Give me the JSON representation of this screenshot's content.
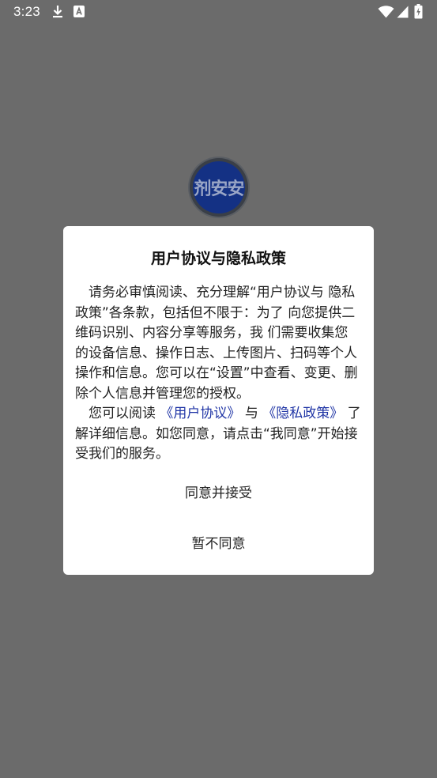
{
  "status_bar": {
    "time": "3:23",
    "icons": [
      "download-icon",
      "font-a-icon",
      "wifi-icon",
      "signal-icon",
      "battery-icon"
    ]
  },
  "app_logo": {
    "text": "剂安安",
    "color": "#143184"
  },
  "dialog": {
    "title": "用户协议与隐私政策",
    "paragraph1": "请务必审慎阅读、充分理解“用户协议与 隐私政策”各条款，包括但不限于：为了 向您提供二维码识别、内容分享等服务，我 们需要收集您的设备信息、操作日志、上传图片、扫码等个人操作和信息。您可以在“设置”中查看、变更、删除个人信息并管理您的授权。",
    "paragraph2_prefix": "您可以阅读",
    "user_agreement_link": "《用户协议》",
    "paragraph2_and": "与",
    "privacy_policy_link": "《隐私政策》",
    "paragraph2_suffix": "了解详细信息。如您同意，请点击“我同意”开始接受我们的服务。",
    "agree_button": "同意并接受",
    "disagree_button": "暂不同意"
  },
  "colors": {
    "overlay": "#6b6b6b",
    "link": "#2136a6",
    "dialog_background": "#ffffff"
  }
}
